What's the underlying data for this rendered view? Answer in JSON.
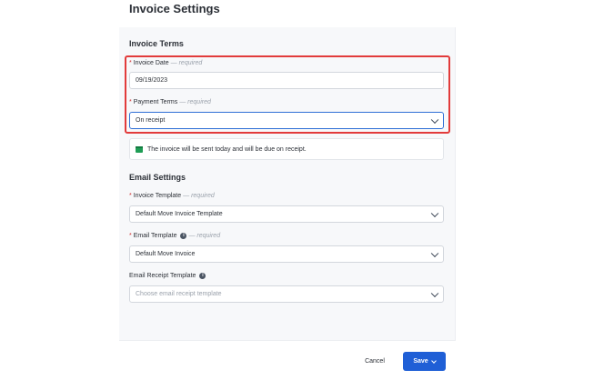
{
  "page": {
    "title": "Invoice Settings"
  },
  "invoice_terms": {
    "heading": "Invoice Terms",
    "invoice_date": {
      "label": "Invoice Date",
      "required_text": "— required",
      "value": "09/19/2023"
    },
    "payment_terms": {
      "label": "Payment Terms",
      "required_text": "— required",
      "value": "On receipt"
    },
    "notice": "The invoice will be sent today and will be due on receipt."
  },
  "email_settings": {
    "heading": "Email Settings",
    "invoice_template": {
      "label": "Invoice Template",
      "required_text": "— required",
      "value": "Default Move Invoice Template"
    },
    "email_template": {
      "label": "Email Template",
      "required_text": "— required",
      "value": "Default Move Invoice"
    },
    "email_receipt_template": {
      "label": "Email Receipt Template",
      "placeholder": "Choose email receipt template"
    }
  },
  "footer": {
    "cancel_label": "Cancel",
    "save_label": "Save"
  },
  "colors": {
    "accent": "#1f5fd6",
    "highlight": "#e23b3b",
    "notice_icon": "#1f9d55"
  }
}
